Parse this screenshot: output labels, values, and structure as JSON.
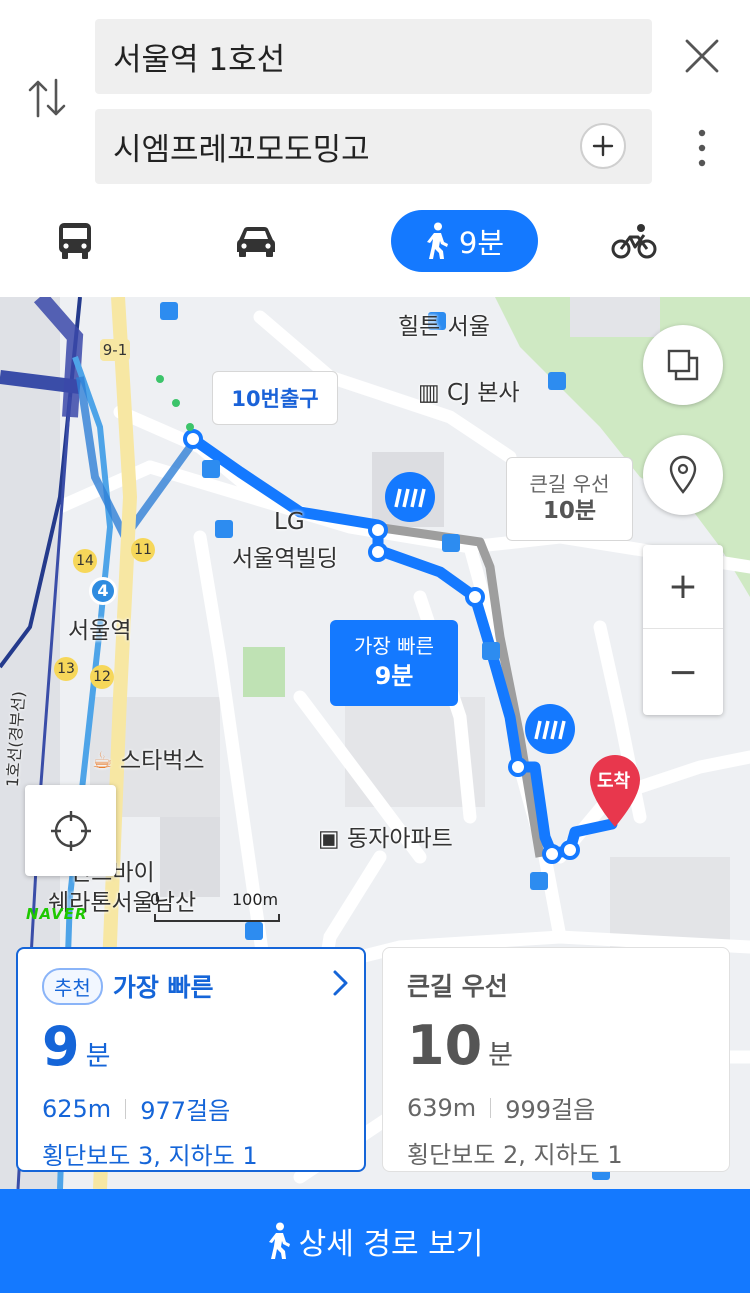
{
  "search": {
    "origin": "서울역 1호선",
    "destination": "시엠프레꼬모도밍고"
  },
  "modes": {
    "walk_time": "9분",
    "selected": "walk"
  },
  "map": {
    "callouts": {
      "exit": "10번출구",
      "bigroad_label": "큰길 우선",
      "bigroad_time": "10분",
      "fast_label": "가장 빠른",
      "fast_time": "9분",
      "arrival": "도착"
    },
    "pois": {
      "hilton": "힐튼 서울",
      "cj": "CJ 본사",
      "lg_1": "LG",
      "lg_2": "서울역빌딩",
      "seoul_station": "서울역",
      "starbucks": "스타벅스",
      "dongja": "동자아파트",
      "inchon": "인츠바이",
      "sheraton": "쉐라톤서울남산",
      "line1": "1호선(경부선)"
    },
    "subway_exits": [
      "9-1",
      "14",
      "11",
      "13",
      "12"
    ],
    "line_badge": "4",
    "scale_zero": "0",
    "scale_label": "100m",
    "naver_logo": "NAVER",
    "zoom_in": "+",
    "zoom_out": "−"
  },
  "routes": [
    {
      "badge": "추천",
      "title": "가장 빠른",
      "time_num": "9",
      "time_unit": "분",
      "distance": "625m",
      "steps": "977걸음",
      "crossings": "횡단보도 3, 지하도 1"
    },
    {
      "title": "큰길 우선",
      "time_num": "10",
      "time_unit": "분",
      "distance": "639m",
      "steps": "999걸음",
      "crossings": "횡단보도 2, 지하도 1"
    }
  ],
  "detail_button": "상세 경로 보기",
  "colors": {
    "accent": "#1479ff",
    "route_dark": "#1565d8",
    "alt_route": "#9e9e9e",
    "arrival_pin": "#e8374d"
  }
}
